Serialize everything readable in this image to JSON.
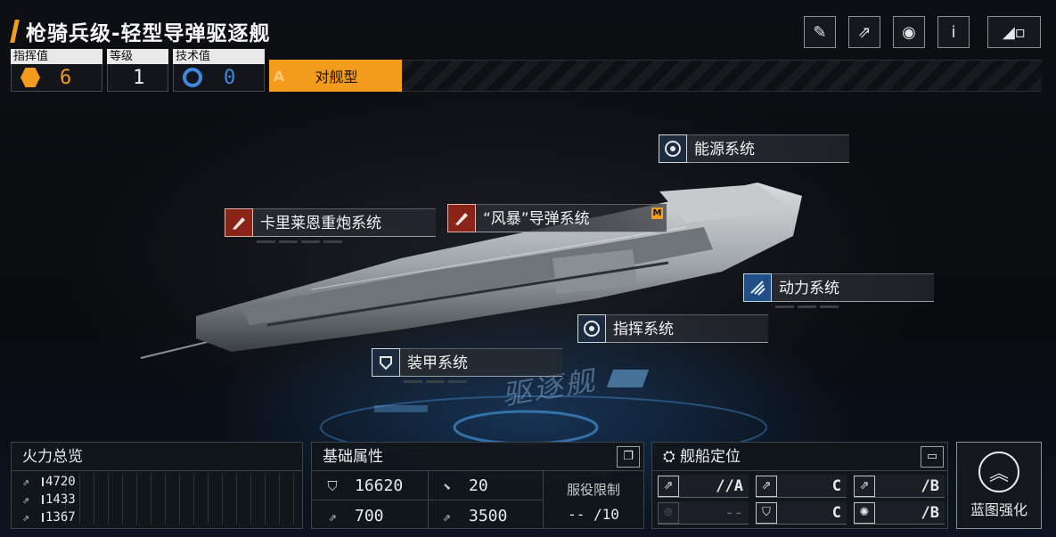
{
  "ship": {
    "title": "枪骑兵级-轻型导弹驱逐舰",
    "type_letter": "A",
    "type_label": "对舰型",
    "hull_text": "驱逐舰"
  },
  "top_buttons": [
    "paint-icon",
    "share-icon",
    "view-icon",
    "info-icon",
    "back-icon"
  ],
  "stats": {
    "command": {
      "label": "指挥值",
      "value": "6",
      "icon": "command-hex-icon",
      "color": "#f29b1d"
    },
    "level": {
      "label": "等级",
      "value": "1"
    },
    "tech": {
      "label": "技术值",
      "value": "0",
      "icon": "tech-icon",
      "color": "#3f8ae0"
    }
  },
  "systems": {
    "energy": "能源系统",
    "artillery": "卡里莱恩重炮系统",
    "missile": "“风暴”导弹系统",
    "missile_badge": "M",
    "propulsion": "动力系统",
    "command": "指挥系统",
    "armor": "装甲系统"
  },
  "firepower": {
    "title": "火力总览",
    "rows": [
      {
        "value": "4720",
        "icon": "cannon-icon"
      },
      {
        "value": "1433",
        "icon": "cannon-icon"
      },
      {
        "value": "1367",
        "icon": "cannon-icon"
      }
    ]
  },
  "base": {
    "title": "基础属性",
    "hp": "16620",
    "armor": "20",
    "speed": "700",
    "range": "3500",
    "service_label": "服役限制",
    "service_value": "-- /10"
  },
  "positioning": {
    "title": "舰船定位",
    "cells": [
      {
        "grade": "//A",
        "dim": false,
        "icon": "anti-ship-icon"
      },
      {
        "grade": "C",
        "dim": false,
        "icon": "anti-air-icon"
      },
      {
        "grade": "/B",
        "dim": false,
        "icon": "siege-icon"
      },
      {
        "grade": "--",
        "dim": true,
        "icon": "support-icon"
      },
      {
        "grade": "C",
        "dim": false,
        "icon": "defense-icon"
      },
      {
        "grade": "/B",
        "dim": false,
        "icon": "utility-icon"
      }
    ]
  },
  "blueprint": {
    "label": "蓝图强化"
  }
}
